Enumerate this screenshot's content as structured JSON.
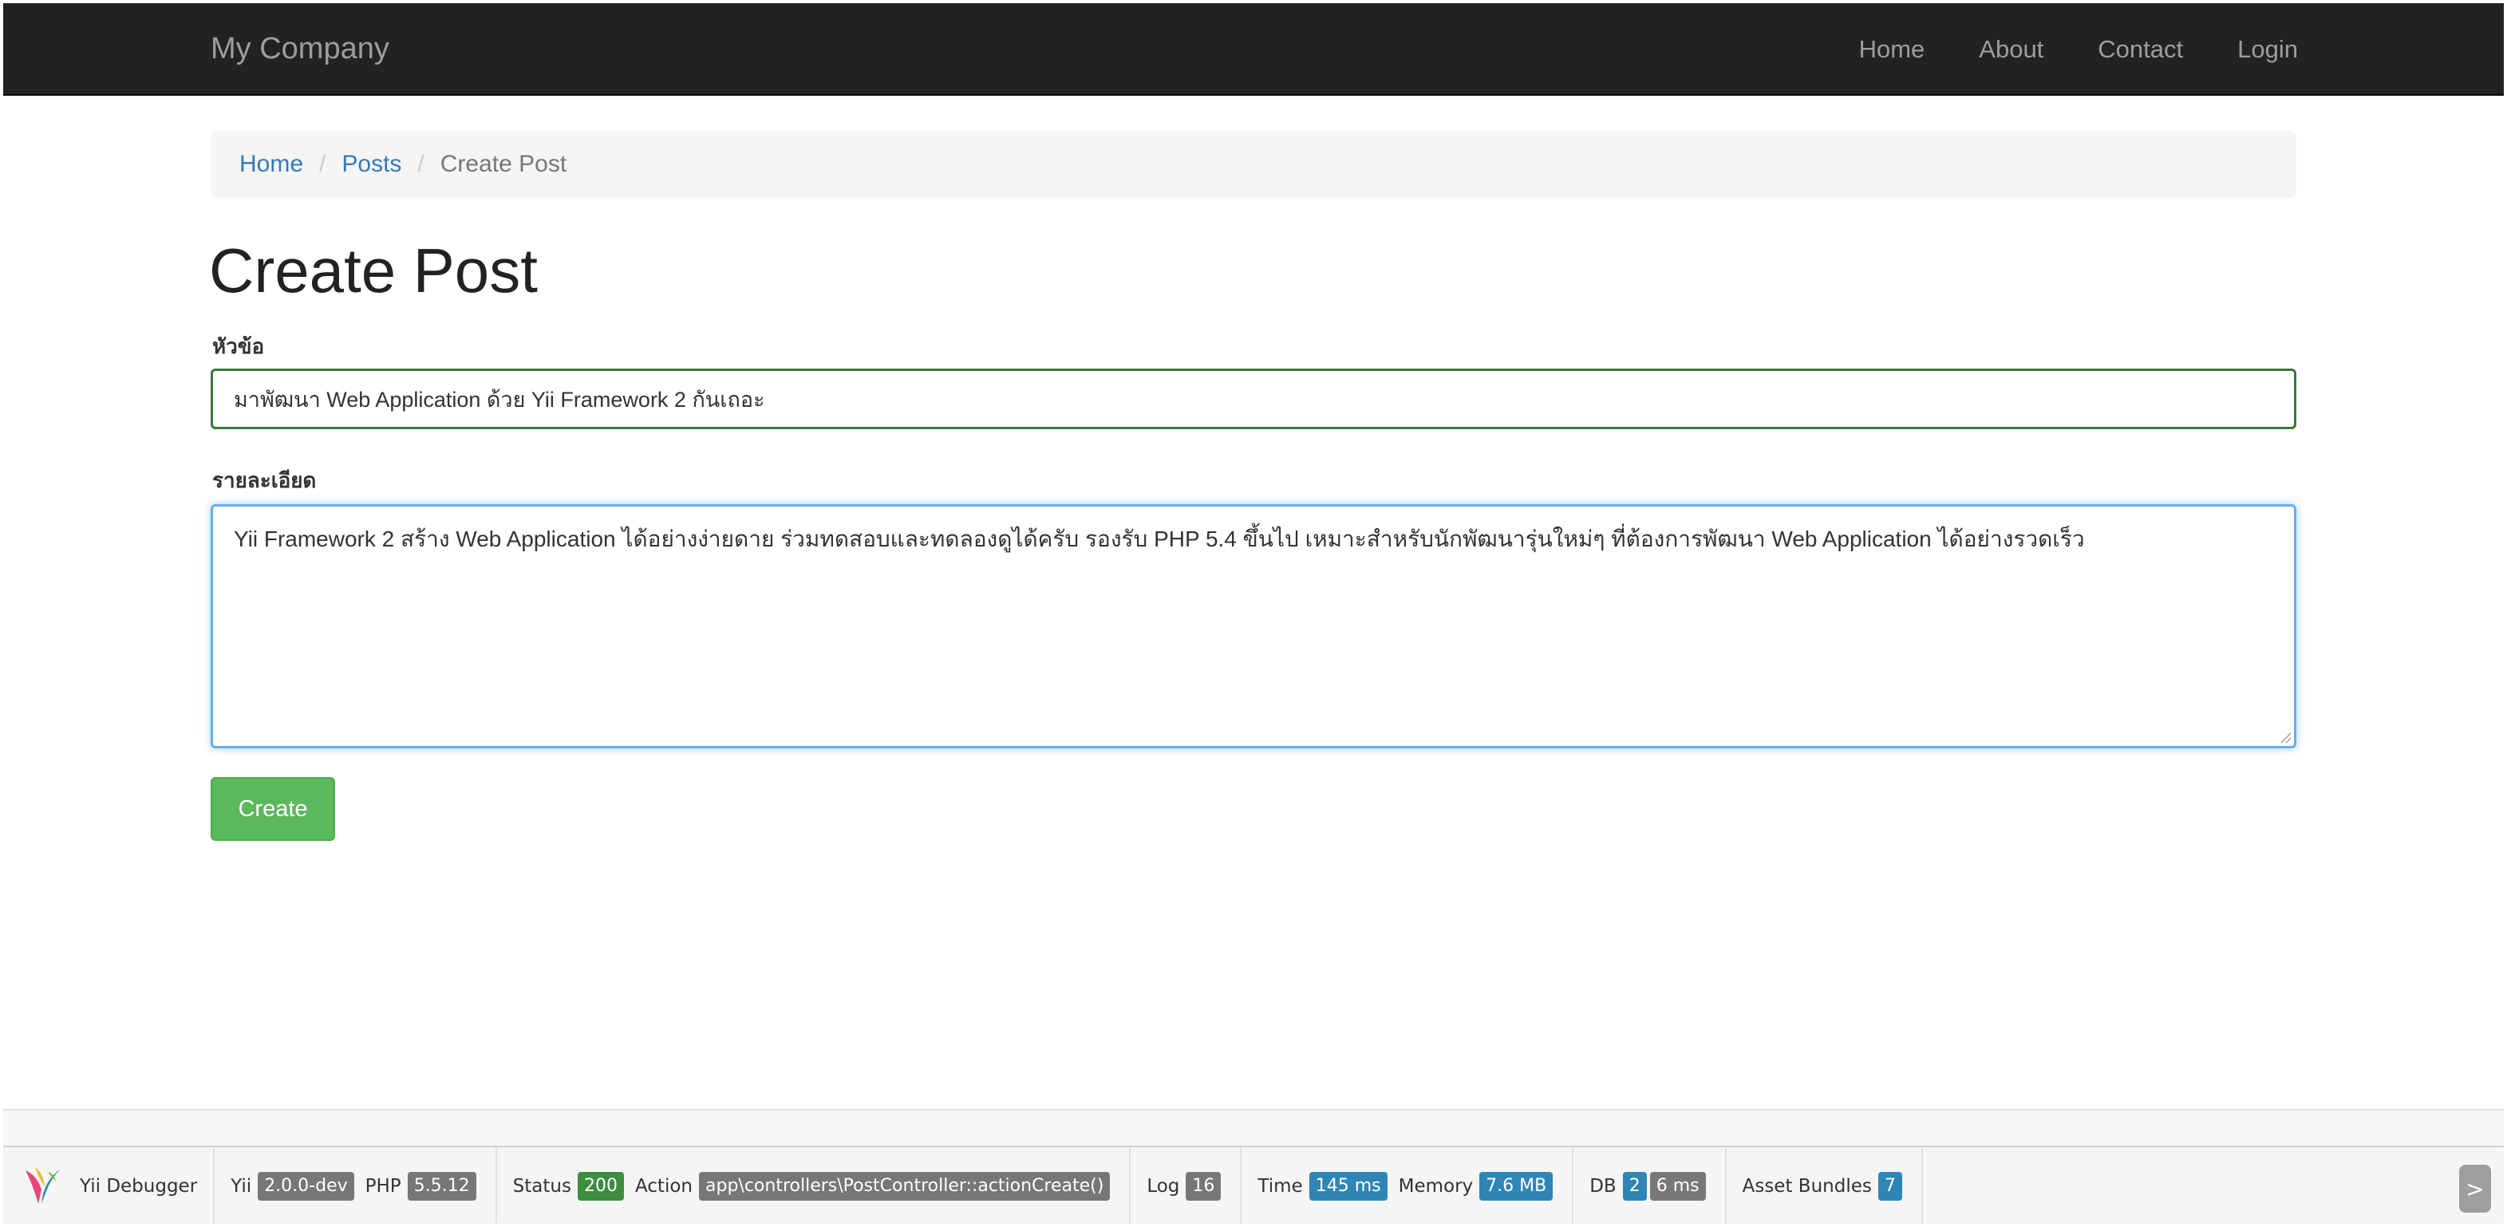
{
  "navbar": {
    "brand": "My Company",
    "links": [
      "Home",
      "About",
      "Contact",
      "Login"
    ]
  },
  "breadcrumb": {
    "items": [
      "Home",
      "Posts"
    ],
    "active": "Create Post",
    "separator": "/"
  },
  "page": {
    "title": "Create Post"
  },
  "form": {
    "title_label": "หัวข้อ",
    "title_value": "มาพัฒนา Web Application ด้วย Yii Framework 2 กันเถอะ",
    "body_label": "รายละเอียด",
    "body_value": "Yii Framework 2 สร้าง Web Application ได้อย่างง่ายดาย ร่วมทดสอบและทดลองดูได้ครับ รองรับ PHP 5.4 ขึ้นไป เหมาะสำหรับนักพัฒนารุ่นใหม่ๆ ที่ต้องการพัฒนา Web Application ได้อย่างรวดเร็ว",
    "submit_label": "Create"
  },
  "debug_toolbar": {
    "name": "Yii Debugger",
    "yii_label": "Yii",
    "yii_version": "2.0.0-dev",
    "php_label": "PHP",
    "php_version": "5.5.12",
    "status_label": "Status",
    "status_code": "200",
    "action_label": "Action",
    "action_value": "app\\controllers\\PostController::actionCreate()",
    "log_label": "Log",
    "log_count": "16",
    "time_label": "Time",
    "time_value": "145 ms",
    "memory_label": "Memory",
    "memory_value": "7.6 MB",
    "db_label": "DB",
    "db_count": "2",
    "db_time": "6 ms",
    "assets_label": "Asset Bundles",
    "assets_count": "7",
    "toggle": ">"
  },
  "colors": {
    "navbar_bg": "#222222",
    "link": "#337ab7",
    "success": "#5cb85c",
    "input_valid_border": "#3c763d",
    "focus_border": "#66afe9"
  }
}
